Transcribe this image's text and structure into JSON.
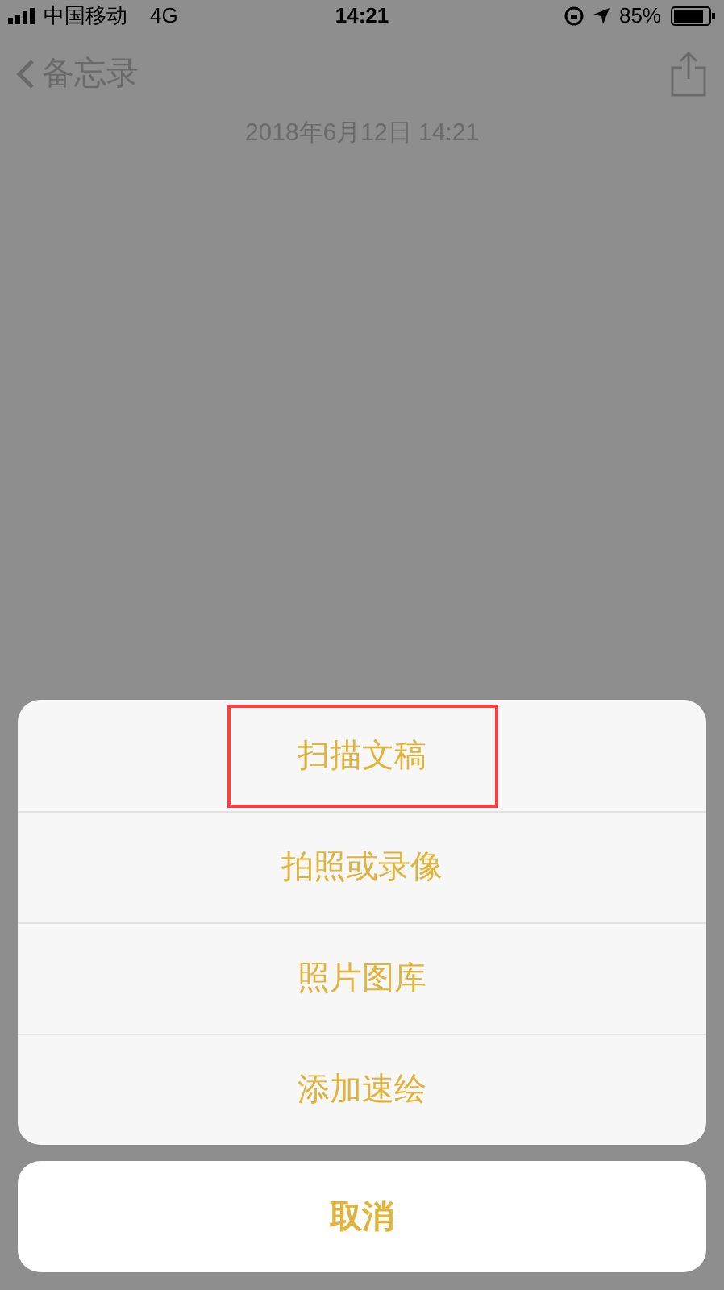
{
  "status_bar": {
    "carrier": "中国移动",
    "network": "4G",
    "time": "14:21",
    "battery": "85%"
  },
  "nav": {
    "back": "备忘录"
  },
  "note": {
    "date": "2018年6月12日 14:21"
  },
  "action_sheet": {
    "options": [
      {
        "label": "扫描文稿",
        "highlighted": true
      },
      {
        "label": "拍照或录像",
        "highlighted": false
      },
      {
        "label": "照片图库",
        "highlighted": false
      },
      {
        "label": "添加速绘",
        "highlighted": false
      }
    ],
    "cancel": "取消"
  }
}
